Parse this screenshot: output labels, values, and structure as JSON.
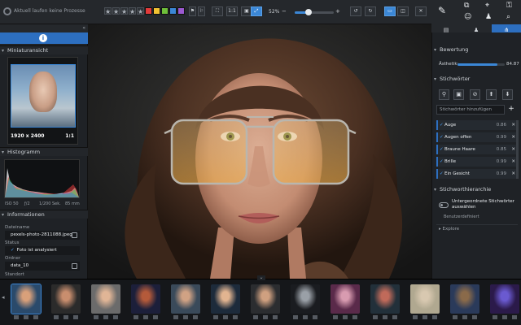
{
  "topbar": {
    "status_text": "Aktuell laufen keine Prozesse",
    "ratio_label": "1:1",
    "zoom": "52%",
    "zoom_fraction": 0.35
  },
  "colors": {
    "accent": "#3b87d6",
    "label_swatches": [
      "#e23b3b",
      "#f1c232",
      "#6fbf3a",
      "#3b87d6",
      "#9b59d0"
    ]
  },
  "left_panel": {
    "thumbnail_section": "Miniaturansicht",
    "thumb_dims": "1920 x 2400",
    "thumb_ratio": "1:1",
    "histogram_section": "Histogramm",
    "histo_meta": [
      "ISO 50",
      "ƒ/2",
      "1/200 Sek.",
      "85 mm"
    ],
    "info_section": "Informationen",
    "info": [
      {
        "label": "Dateiname",
        "value": "pexels-photo-2811088.jpeg",
        "copy": true
      },
      {
        "label": "Status",
        "value": "Foto ist analysiert",
        "check": true
      },
      {
        "label": "Ordner",
        "value": "data_10",
        "copy": true
      },
      {
        "label": "Standort",
        "value": ""
      }
    ]
  },
  "right_panel": {
    "rating_section": "Bewertung",
    "aesthetic_label": "Ästhetik:",
    "aesthetic_value": "84.87",
    "aesthetic_fraction": 0.85,
    "keywords_section": "Stichwörter",
    "add_placeholder": "Stichwörter hinzufügen",
    "keywords": [
      {
        "name": "Auge",
        "score": "0.86"
      },
      {
        "name": "Augen offen",
        "score": "0.99"
      },
      {
        "name": "Braune Haare",
        "score": "0.85"
      },
      {
        "name": "Brille",
        "score": "0.99"
      },
      {
        "name": "Ein Gesicht",
        "score": "0.99"
      }
    ],
    "hierarchy_section": "Stichworthierarchie",
    "hierarchy_toggle_label": "Untergeordnete Stichwörter auswählen",
    "hierarchy_sub": "Benutzerdefiniert",
    "explore": "Explore"
  },
  "filmstrip": {
    "count": 13
  }
}
